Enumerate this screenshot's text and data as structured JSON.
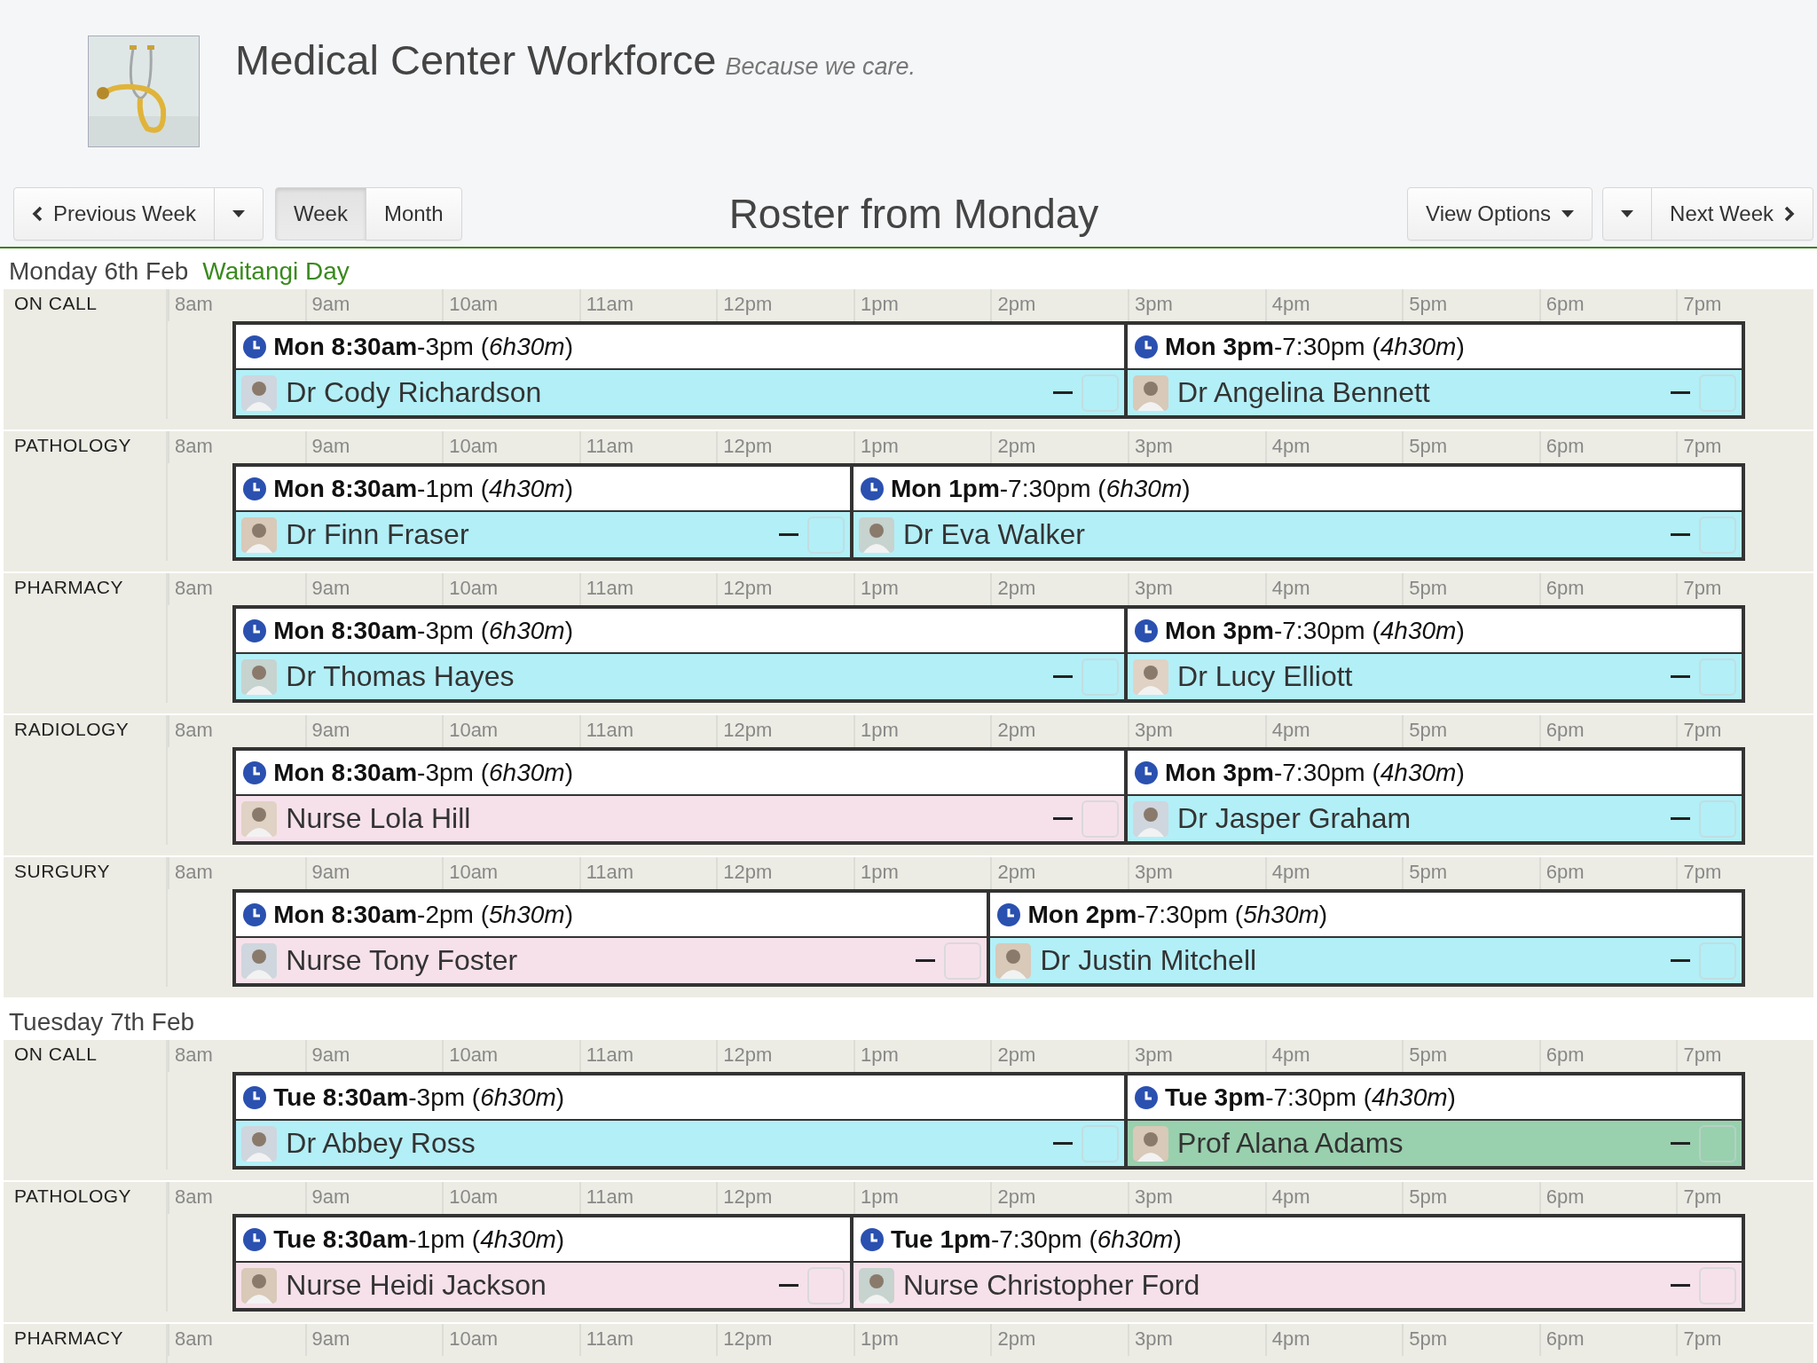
{
  "header": {
    "title": "Medical Center Workforce",
    "tagline": "Because we care."
  },
  "toolbar": {
    "previous": "Previous Week",
    "views": [
      {
        "label": "Week",
        "selected": true
      },
      {
        "label": "Month",
        "selected": false
      }
    ],
    "title": "Roster from Monday",
    "view_options": "View Options",
    "next": "Next Week"
  },
  "days": [
    {
      "date": "Monday 6th Feb",
      "holiday": "Waitangi Day",
      "departments": [
        {
          "name": "ON CALL",
          "hours": [
            "8am",
            "9am",
            "10am",
            "11am",
            "12pm",
            "1pm",
            "2pm",
            "3pm",
            "4pm",
            "5pm",
            "6pm",
            "7pm"
          ],
          "shifts": [
            {
              "time": "**Mon 8:30am**-3pm (*6h30m*)",
              "staff": "Dr Cody Richardson",
              "color": "#b3eff7",
              "checked": false
            },
            {
              "time": "**Mon 3pm**-7:30pm (*4h30m*)",
              "staff": "Dr Angelina Bennett",
              "color": "#b3eff7",
              "checked": false
            }
          ]
        },
        {
          "name": "PATHOLOGY",
          "hours": [
            "8am",
            "9am",
            "10am",
            "11am",
            "12pm",
            "1pm",
            "2pm",
            "3pm",
            "4pm",
            "5pm",
            "6pm",
            "7pm"
          ],
          "shifts": [
            {
              "time": "**Mon 8:30am**-1pm (*4h30m*)",
              "staff": "Dr Finn Fraser",
              "color": "#b3eff7",
              "checked": false
            },
            {
              "time": "**Mon 1pm**-7:30pm (*6h30m*)",
              "staff": "Dr Eva Walker",
              "color": "#b3eff7",
              "checked": false
            }
          ]
        },
        {
          "name": "PHARMACY",
          "hours": [
            "8am",
            "9am",
            "10am",
            "11am",
            "12pm",
            "1pm",
            "2pm",
            "3pm",
            "4pm",
            "5pm",
            "6pm",
            "7pm"
          ],
          "shifts": [
            {
              "time": "**Mon 8:30am**-3pm (*6h30m*)",
              "staff": "Dr Thomas Hayes",
              "color": "#b3eff7",
              "checked": false
            },
            {
              "time": "**Mon 3pm**-7:30pm (*4h30m*)",
              "staff": "Dr Lucy Elliott",
              "color": "#b3eff7",
              "checked": false
            }
          ]
        },
        {
          "name": "RADIOLOGY",
          "hours": [
            "8am",
            "9am",
            "10am",
            "11am",
            "12pm",
            "1pm",
            "2pm",
            "3pm",
            "4pm",
            "5pm",
            "6pm",
            "7pm"
          ],
          "shifts": [
            {
              "time": "**Mon 8:30am**-3pm (*6h30m*)",
              "staff": "Nurse Lola Hill",
              "color": "#f6e1ea",
              "checked": false
            },
            {
              "time": "**Mon 3pm**-7:30pm (*4h30m*)",
              "staff": "Dr Jasper Graham",
              "color": "#b3eff7",
              "checked": false
            }
          ]
        },
        {
          "name": "SURGURY",
          "hours": [
            "8am",
            "9am",
            "10am",
            "11am",
            "12pm",
            "1pm",
            "2pm",
            "3pm",
            "4pm",
            "5pm",
            "6pm",
            "7pm"
          ],
          "shifts": [
            {
              "time": "**Mon 8:30am**-2pm (*5h30m*)",
              "staff": "Nurse Tony Foster",
              "color": "#f6e1ea",
              "checked": false
            },
            {
              "time": "**Mon 2pm**-7:30pm (*5h30m*)",
              "staff": "Dr Justin Mitchell",
              "color": "#b3eff7",
              "checked": false
            }
          ]
        }
      ]
    },
    {
      "date": "Tuesday 7th Feb",
      "departments": [
        {
          "name": "ON CALL",
          "hours": [
            "8am",
            "9am",
            "10am",
            "11am",
            "12pm",
            "1pm",
            "2pm",
            "3pm",
            "4pm",
            "5pm",
            "6pm",
            "7pm"
          ],
          "shifts": [
            {
              "time": "**Tue 8:30am**-3pm (*6h30m*)",
              "staff": "Dr Abbey Ross",
              "color": "#b3eff7",
              "checked": false
            },
            {
              "time": "**Tue 3pm**-7:30pm (*4h30m*)",
              "staff": "Prof Alana Adams",
              "color": "#99d0ae",
              "checked": false
            }
          ]
        },
        {
          "name": "PATHOLOGY",
          "hours": [
            "8am",
            "9am",
            "10am",
            "11am",
            "12pm",
            "1pm",
            "2pm",
            "3pm",
            "4pm",
            "5pm",
            "6pm",
            "7pm"
          ],
          "shifts": [
            {
              "time": "**Tue 8:30am**-1pm (*4h30m*)",
              "staff": "Nurse Heidi Jackson",
              "color": "#f6e1ea",
              "checked": false
            },
            {
              "time": "**Tue 1pm**-7:30pm (*6h30m*)",
              "staff": "Nurse Christopher Ford",
              "color": "#f6e1ea",
              "checked": false
            }
          ]
        },
        {
          "name": "PHARMACY",
          "hours": [
            "8am",
            "9am",
            "10am",
            "11am",
            "12pm",
            "1pm",
            "2pm",
            "3pm",
            "4pm",
            "5pm",
            "6pm",
            "7pm"
          ]
        }
      ]
    }
  ]
}
